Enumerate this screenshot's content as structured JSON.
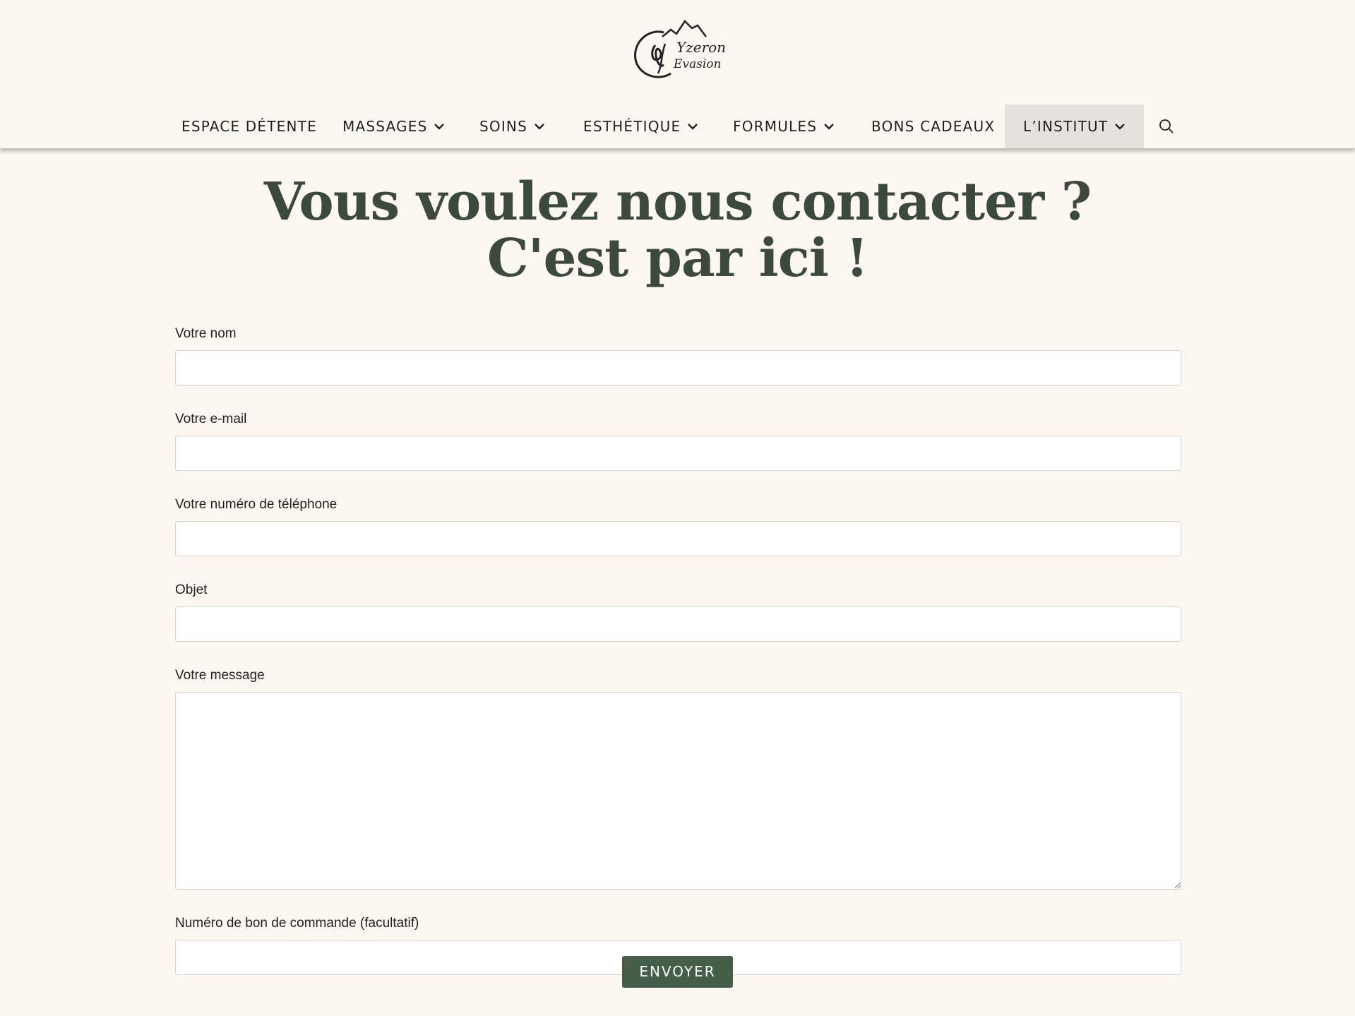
{
  "brand": {
    "logo_text_1": "Yzeron",
    "logo_text_2": "Evasion"
  },
  "nav": {
    "items": [
      {
        "label": "ESPACE DÉTENTE",
        "has_dropdown": false
      },
      {
        "label": "MASSAGES",
        "has_dropdown": true
      },
      {
        "label": "SOINS",
        "has_dropdown": true
      },
      {
        "label": "ESTHÉTIQUE",
        "has_dropdown": true
      },
      {
        "label": "FORMULES",
        "has_dropdown": true
      },
      {
        "label": "BONS CADEAUX",
        "has_dropdown": false
      },
      {
        "label": "L’INSTITUT",
        "has_dropdown": true,
        "active": true
      }
    ],
    "search_icon": "search-icon"
  },
  "headline": {
    "line1": "Vous voulez nous contacter ?",
    "line2": "C'est par ici !"
  },
  "form": {
    "name_label": "Votre nom",
    "name_value": "",
    "email_label": "Votre e-mail",
    "email_value": "",
    "phone_label": "Votre numéro de téléphone",
    "phone_value": "",
    "subject_label": "Objet",
    "subject_value": "",
    "message_label": "Votre message",
    "message_value": "",
    "order_label": "Numéro de bon de commande (facultatif)",
    "order_value": "",
    "submit_label": "ENVOYER"
  },
  "colors": {
    "background": "#fdf7f1",
    "headline": "#3b4a3c",
    "button": "#455e47",
    "nav_active_bg": "#e6e1dc"
  }
}
